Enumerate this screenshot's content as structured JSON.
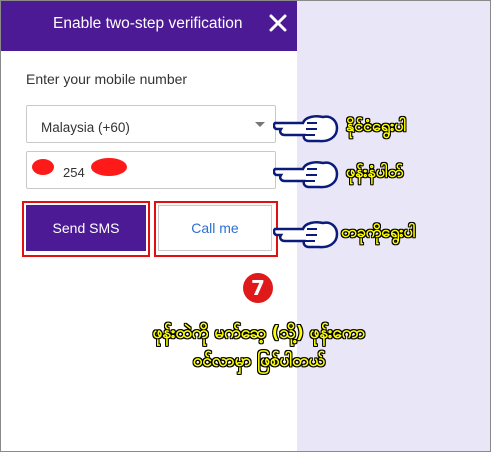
{
  "dialog": {
    "title": "Enable two-step verification",
    "close_icon": "close-icon"
  },
  "form": {
    "label": "Enter your mobile number",
    "country_value": "Malaysia (+60)",
    "phone_value_visible": "254"
  },
  "buttons": {
    "send_sms": "Send SMS",
    "call_me": "Call me"
  },
  "annotations": {
    "note_country": "နိုင်ငံရွေးပါ",
    "note_phone": "ဖုန်းနံပါတ်",
    "note_choose": "တခုကိုရွေးပါ",
    "step_number": "7",
    "caption_line1": "ဖုန်းထဲကို မက်ဆေ့ (သို့) ဖုန်းကော",
    "caption_line2": "ဝင်လာမှာ ဖြစ်ပါတယ်"
  },
  "colors": {
    "header": "#4c1a94",
    "highlight": "#e01010",
    "annotation_text": "#ffff00",
    "backdrop": "#e8e6f7"
  }
}
